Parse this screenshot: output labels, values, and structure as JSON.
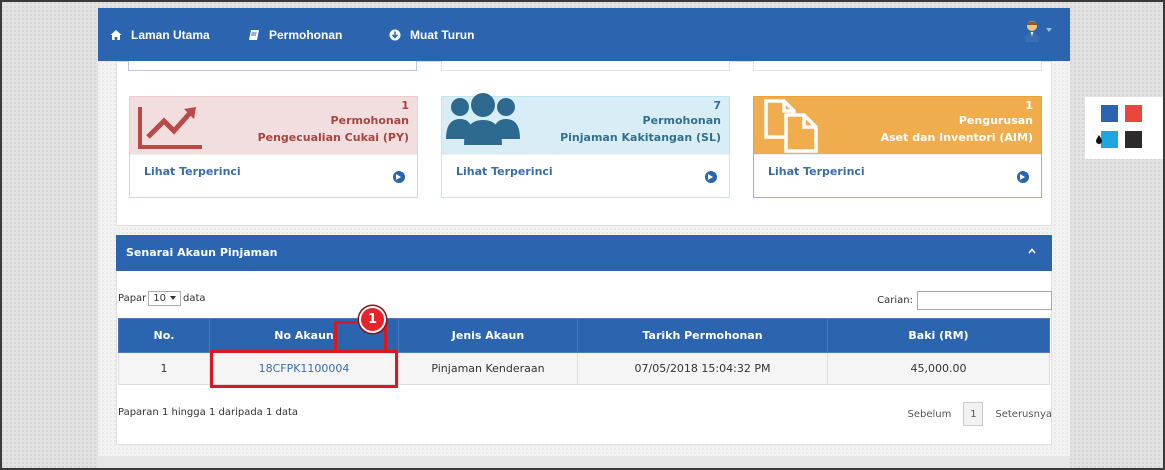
{
  "nav": {
    "home_label": "Laman Utama",
    "applications_label": "Permohonan",
    "download_label": "Muat Turun"
  },
  "cards": [
    {
      "count": "1",
      "line1": "Permohonan",
      "line2": "Pengecualian Cukai (PY)",
      "link": "Lihat Terperinci",
      "icon": "chart-trend-icon"
    },
    {
      "count": "7",
      "line1": "Permohonan",
      "line2": "Pinjaman Kakitangan (SL)",
      "link": "Lihat Terperinci",
      "icon": "users-group-icon"
    },
    {
      "count": "1",
      "line1": "Pengurusan",
      "line2": "Aset dan Inventori (AIM)",
      "link": "Lihat Terperinci",
      "icon": "copy-documents-icon"
    }
  ],
  "theme_colors": [
    "#2b65b0",
    "#e8473c",
    "#1ea6e0",
    "#2b2b2b"
  ],
  "loan_panel": {
    "title": "Senarai Akaun Pinjaman",
    "length_prefix": "Papar",
    "length_value": "10",
    "length_suffix": "data",
    "search_label": "Carian:",
    "search_value": "",
    "columns": [
      "No.",
      "No Akaun",
      "Jenis Akaun",
      "Tarikh Permohonan",
      "Baki (RM)"
    ],
    "rows": [
      {
        "no": "1",
        "account": "18CFPK1100004",
        "type": "Pinjaman Kenderaan",
        "date": "07/05/2018 15:04:32 PM",
        "balance": "45,000.00"
      }
    ],
    "info": "Paparan 1 hingga 1 daripada 1 data",
    "prev_label": "Sebelum",
    "page": "1",
    "next_label": "Seterusnya"
  },
  "annotation": {
    "step": "1"
  }
}
